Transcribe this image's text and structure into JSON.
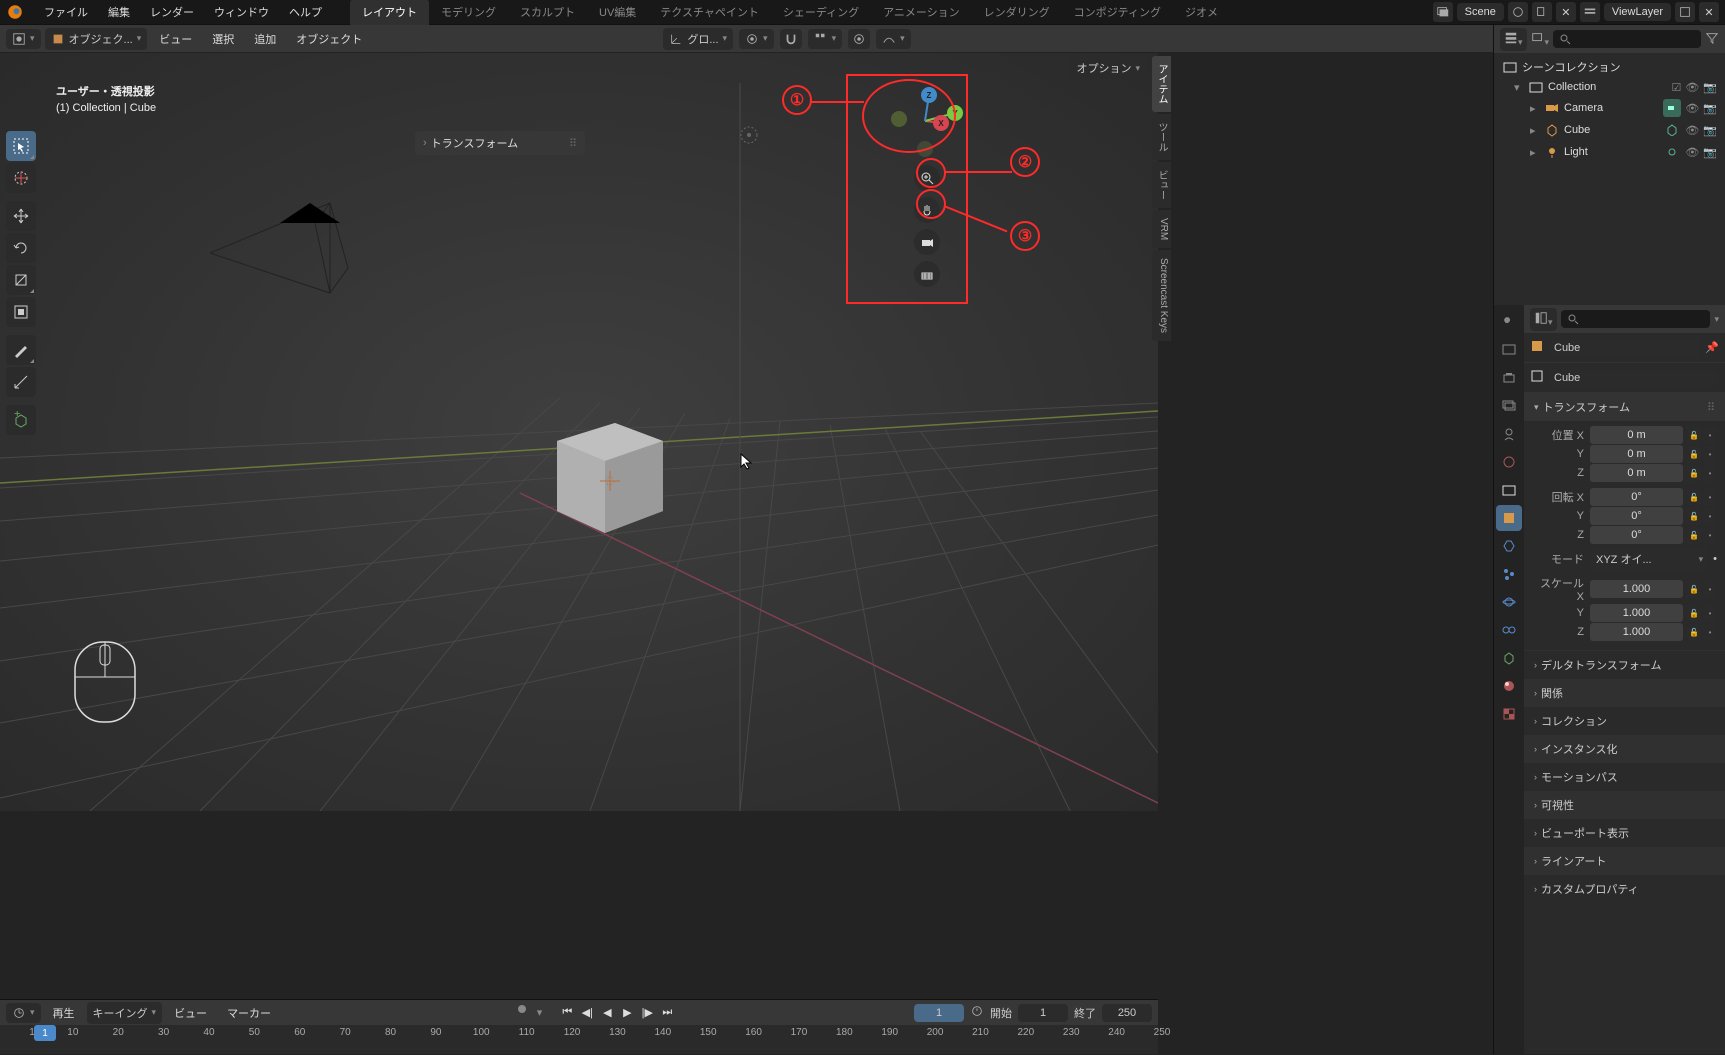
{
  "topbar": {
    "menus": [
      "ファイル",
      "編集",
      "レンダー",
      "ウィンドウ",
      "ヘルプ"
    ],
    "workspaces": [
      "レイアウト",
      "モデリング",
      "スカルプト",
      "UV編集",
      "テクスチャペイント",
      "シェーディング",
      "アニメーション",
      "レンダリング",
      "コンポジティング",
      "ジオメ"
    ],
    "active_workspace": 0,
    "scene_label": "Scene",
    "viewlayer_label": "ViewLayer"
  },
  "vp_header": {
    "editor_icon": "3dview",
    "mode_label": "オブジェク...",
    "menus": [
      "ビュー",
      "選択",
      "追加",
      "オブジェクト"
    ],
    "transform_orient": "グロ...",
    "options_label": "オプション"
  },
  "overlay": {
    "line1": "ユーザー・透視投影",
    "line2": "(1) Collection | Cube"
  },
  "side_tabs": [
    "アイテム",
    "ツール",
    "ビュー",
    "VRM",
    "Screencast Keys"
  ],
  "active_side_tab": 0,
  "transform_panel_label": "トランスフォーム",
  "annotations": {
    "n1": "①",
    "n2": "②",
    "n3": "③"
  },
  "timeline": {
    "menus_left": [
      "再生",
      "キーイング"
    ],
    "menus_right": [
      "ビュー",
      "マーカー"
    ],
    "current_frame": "1",
    "start_label": "開始",
    "start_val": "1",
    "end_label": "終了",
    "end_val": "250",
    "ticks": [
      1,
      10,
      20,
      30,
      40,
      50,
      60,
      70,
      80,
      90,
      100,
      110,
      120,
      130,
      140,
      150,
      160,
      170,
      180,
      190,
      200,
      210,
      220,
      230,
      240,
      250
    ]
  },
  "outliner": {
    "title": "シーンコレクション",
    "items": [
      {
        "name": "Collection",
        "indent": 1,
        "kind": "collection",
        "tint": "#c8c8c8"
      },
      {
        "name": "Camera",
        "indent": 2,
        "kind": "camera",
        "tint": "#5bb28f"
      },
      {
        "name": "Cube",
        "indent": 2,
        "kind": "mesh",
        "tint": "#d89a4a"
      },
      {
        "name": "Light",
        "indent": 2,
        "kind": "light",
        "tint": "#5bb28f"
      }
    ]
  },
  "props": {
    "obj_name": "Cube",
    "mesh_name": "Cube",
    "transform_hdr": "トランスフォーム",
    "loc_label": "位置 X",
    "loc": {
      "x": "0 m",
      "y": "0 m",
      "z": "0 m"
    },
    "rot_label": "回転 X",
    "rot": {
      "x": "0°",
      "y": "0°",
      "z": "0°"
    },
    "mode_label": "モード",
    "mode_val": "XYZ オイ...",
    "scale_label": "スケール X",
    "scale": {
      "x": "1.000",
      "y": "1.000",
      "z": "1.000"
    },
    "axis_y": "Y",
    "axis_z": "Z",
    "panels_collapsed": [
      "デルタトランスフォーム",
      "関係",
      "コレクション",
      "インスタンス化",
      "モーションパス",
      "可視性",
      "ビューポート表示",
      "ラインアート",
      "カスタムプロパティ"
    ]
  }
}
